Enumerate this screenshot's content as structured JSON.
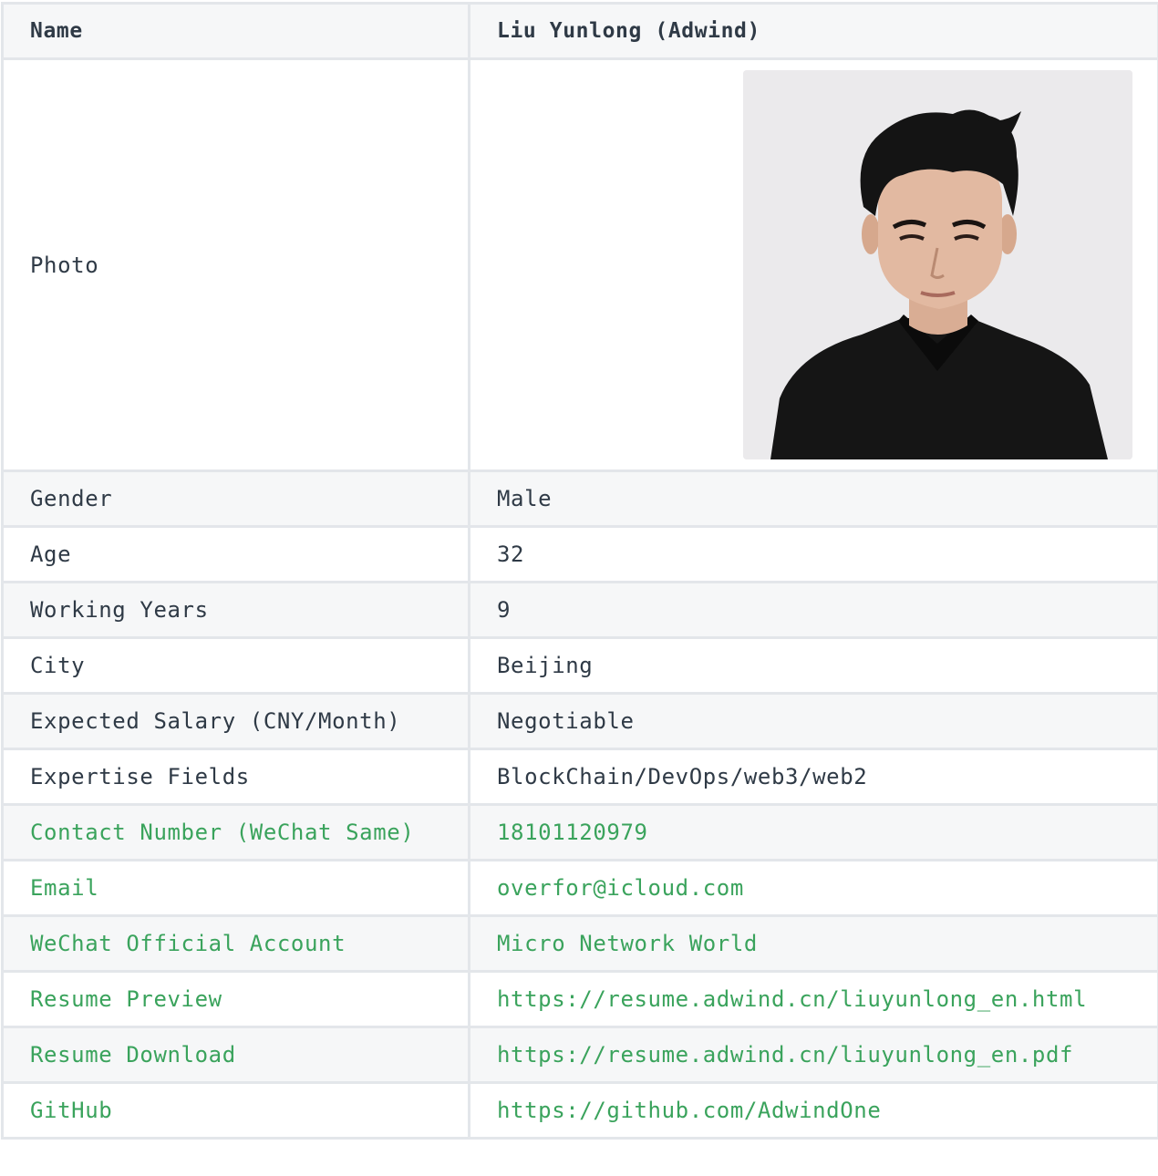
{
  "header": {
    "label": "Name",
    "value": "Liu Yunlong (Adwind)"
  },
  "photo_row": {
    "label": "Photo",
    "image_desc": "portrait-photo"
  },
  "rows": [
    {
      "label": "Gender",
      "value": "Male"
    },
    {
      "label": "Age",
      "value": "32"
    },
    {
      "label": "Working Years",
      "value": "9"
    },
    {
      "label": "City",
      "value": "Beijing"
    },
    {
      "label": "Expected Salary (CNY/Month)",
      "value": "Negotiable"
    },
    {
      "label": "Expertise Fields",
      "value": "BlockChain/DevOps/web3/web2"
    }
  ],
  "link_rows": [
    {
      "label": "Contact Number (WeChat Same)",
      "value": "18101120979"
    },
    {
      "label": "Email",
      "value": "overfor@icloud.com"
    },
    {
      "label": "WeChat Official Account",
      "value": "Micro Network World"
    },
    {
      "label": "Resume Preview",
      "value": "https://resume.adwind.cn/liuyunlong_en.html"
    },
    {
      "label": "Resume Download",
      "value": "https://resume.adwind.cn/liuyunlong_en.pdf"
    },
    {
      "label": "GitHub",
      "value": "https://github.com/AdwindOne"
    }
  ],
  "colors": {
    "link": "#3aa35c",
    "text": "#2f3a46",
    "row_shade": "#f6f7f8",
    "border": "#e3e6ea"
  }
}
